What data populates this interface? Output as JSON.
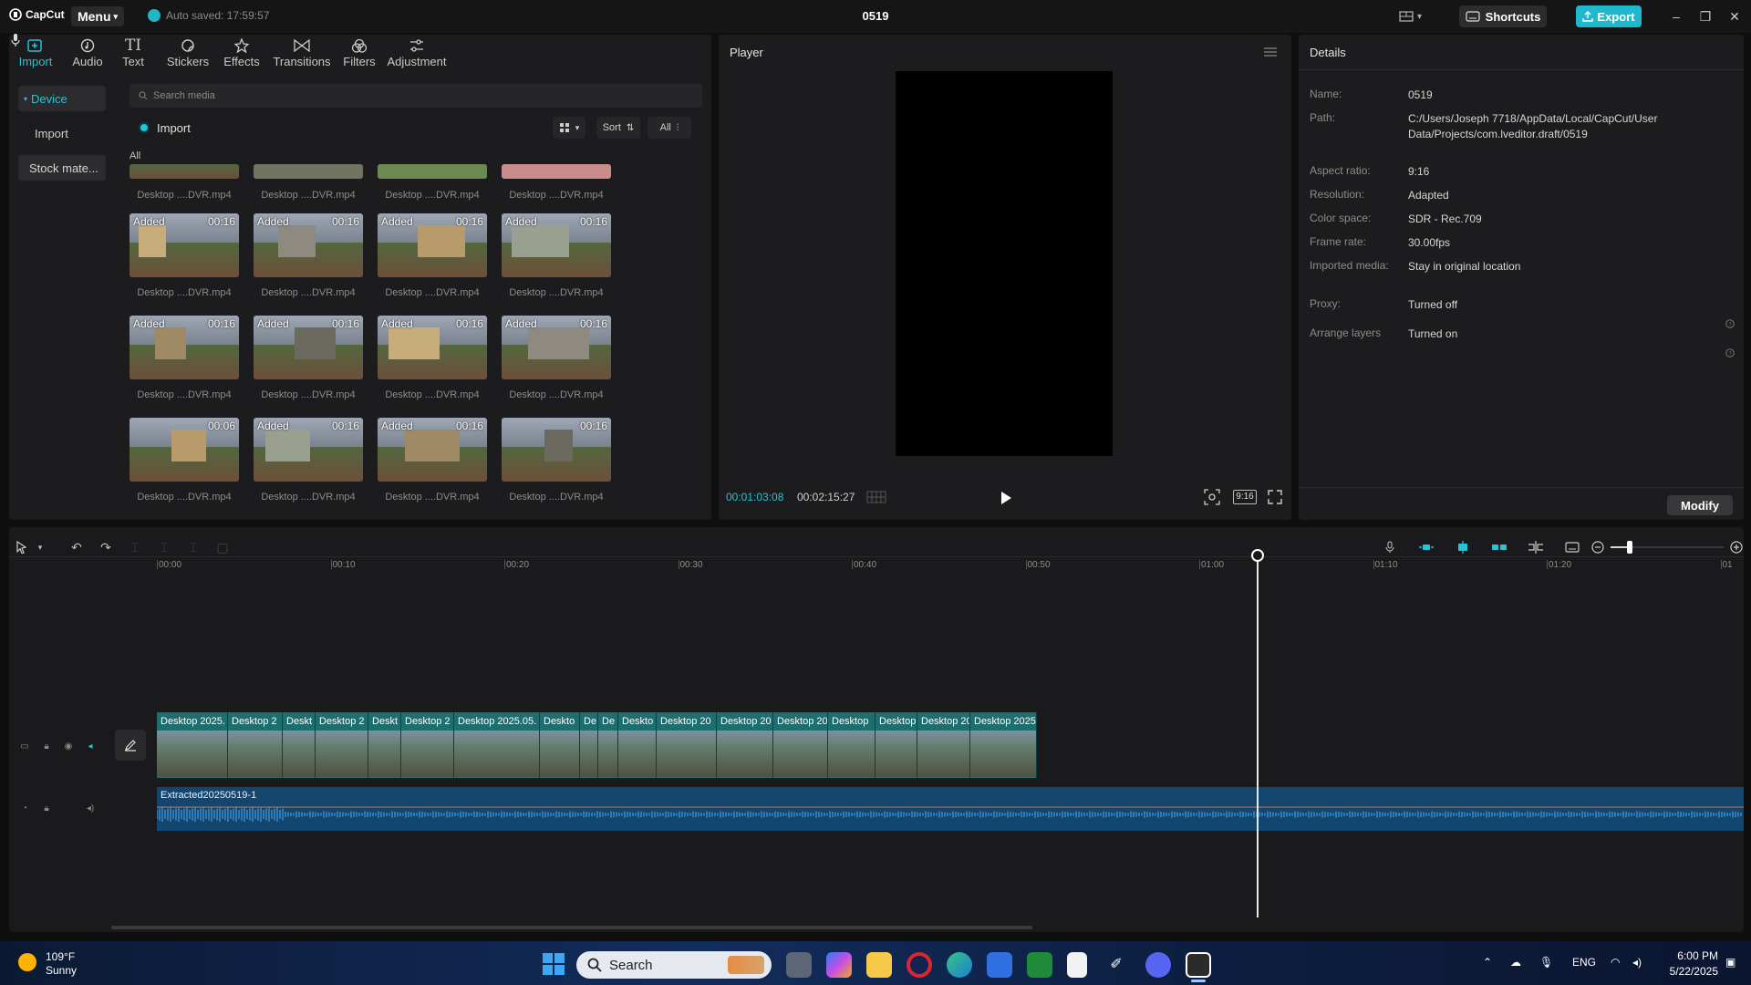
{
  "app": {
    "logo_text": "CapCut",
    "menu_label": "Menu",
    "autosave": "Auto saved: 17:59:57",
    "project_title": "0519",
    "shortcuts_label": "Shortcuts",
    "export_label": "Export",
    "accent": "#22c4d8"
  },
  "toolbar": {
    "tabs": [
      {
        "label": "Import",
        "icon": "import-icon"
      },
      {
        "label": "Audio",
        "icon": "audio-icon"
      },
      {
        "label": "Text",
        "icon": "text-icon"
      },
      {
        "label": "Stickers",
        "icon": "sticker-icon"
      },
      {
        "label": "Effects",
        "icon": "effects-icon"
      },
      {
        "label": "Transitions",
        "icon": "transitions-icon"
      },
      {
        "label": "Filters",
        "icon": "filters-icon"
      },
      {
        "label": "Adjustment",
        "icon": "adjustment-icon"
      }
    ]
  },
  "sidebar": {
    "items": [
      {
        "label": "Device"
      },
      {
        "label": "Import"
      },
      {
        "label": "Stock mate..."
      }
    ]
  },
  "media": {
    "search_placeholder": "Search media",
    "import_label": "Import",
    "sort_label": "Sort",
    "filter_label": "All",
    "all_label": "All",
    "top_row_names": [
      "Desktop ....DVR.mp4",
      "Desktop ....DVR.mp4",
      "Desktop ....DVR.mp4",
      "Desktop ....DVR.mp4"
    ],
    "items": [
      {
        "badge": "Added",
        "duration": "00:16",
        "name": "Desktop ....DVR.mp4"
      },
      {
        "badge": "Added",
        "duration": "00:16",
        "name": "Desktop ....DVR.mp4"
      },
      {
        "badge": "Added",
        "duration": "00:16",
        "name": "Desktop ....DVR.mp4"
      },
      {
        "badge": "Added",
        "duration": "00:16",
        "name": "Desktop ....DVR.mp4"
      },
      {
        "badge": "Added",
        "duration": "00:16",
        "name": "Desktop ....DVR.mp4"
      },
      {
        "badge": "Added",
        "duration": "00:16",
        "name": "Desktop ....DVR.mp4"
      },
      {
        "badge": "Added",
        "duration": "00:16",
        "name": "Desktop ....DVR.mp4"
      },
      {
        "badge": "Added",
        "duration": "00:16",
        "name": "Desktop ....DVR.mp4"
      },
      {
        "badge": "",
        "duration": "00:06",
        "name": "Desktop ....DVR.mp4"
      },
      {
        "badge": "Added",
        "duration": "00:16",
        "name": "Desktop ....DVR.mp4"
      },
      {
        "badge": "Added",
        "duration": "00:16",
        "name": "Desktop ....DVR.mp4"
      },
      {
        "badge": "",
        "duration": "00:16",
        "name": "Desktop ....DVR.mp4"
      }
    ]
  },
  "player": {
    "title": "Player",
    "current_time": "00:01:03:08",
    "total_time": "00:02:15:27",
    "ratio_label": "9:16"
  },
  "details": {
    "title": "Details",
    "rows": [
      {
        "key": "Name:",
        "value": "0519"
      },
      {
        "key": "Path:",
        "value": "C:/Users/Joseph 7718/AppData/Local/CapCut/User Data/Projects/com.lveditor.draft/0519"
      },
      {
        "key": "Aspect ratio:",
        "value": "9:16"
      },
      {
        "key": "Resolution:",
        "value": "Adapted"
      },
      {
        "key": "Color space:",
        "value": "SDR - Rec.709"
      },
      {
        "key": "Frame rate:",
        "value": "30.00fps"
      },
      {
        "key": "Imported media:",
        "value": "Stay in original location"
      },
      {
        "key": "Proxy:",
        "value": "Turned off"
      },
      {
        "key": "Arrange layers",
        "value": "Turned on"
      }
    ],
    "modify_label": "Modify"
  },
  "timeline": {
    "ruler": [
      "00:00",
      "00:10",
      "00:20",
      "00:30",
      "00:40",
      "00:50",
      "01:00",
      "01:10",
      "01:20",
      "01"
    ],
    "clips": [
      "Desktop 2025.",
      "Desktop 2",
      "Deskt",
      "Desktop 2",
      "Deskt",
      "Desktop 2",
      "Desktop 2025.05.",
      "Deskto",
      "De",
      "De",
      "Deskto",
      "Desktop 20",
      "Desktop 20",
      "Desktop 20",
      "Desktop",
      "Desktop",
      "Desktop 20",
      "Desktop 2025"
    ],
    "audio_label": "Extracted20250519-1"
  },
  "taskbar": {
    "temperature": "109°F",
    "weather": "Sunny",
    "search_label": "Search",
    "lang": "ENG",
    "time": "6:00 PM",
    "date": "5/22/2025"
  }
}
